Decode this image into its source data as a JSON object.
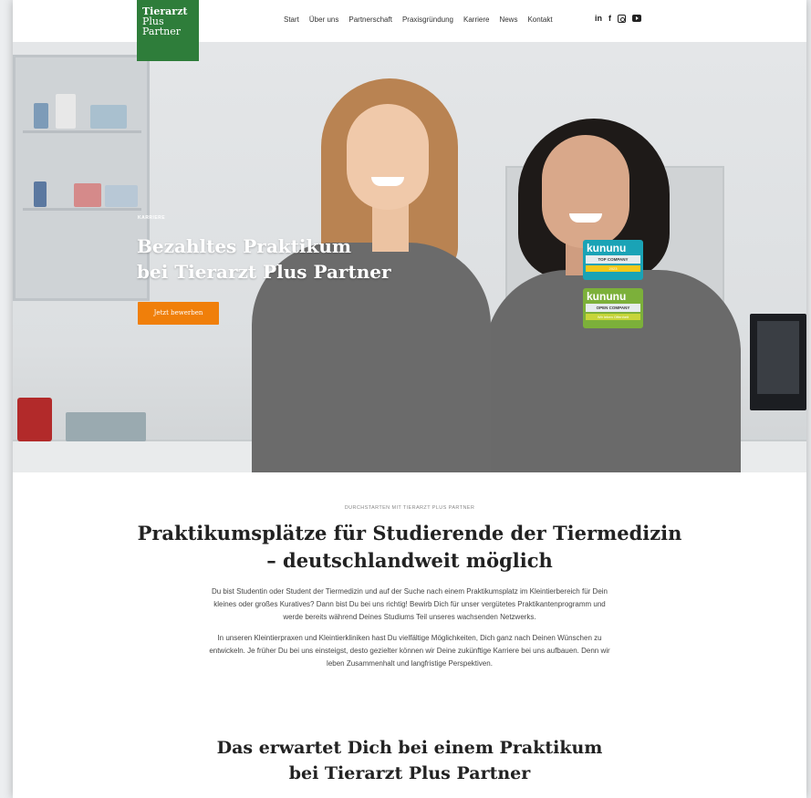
{
  "logo": {
    "line1": "Tierarzt",
    "line2": "Plus",
    "line3": "Partner"
  },
  "nav": {
    "items": [
      "Start",
      "Über uns",
      "Partnerschaft",
      "Praxisgründung",
      "Karriere",
      "News",
      "Kontakt"
    ]
  },
  "social": {
    "icons": [
      "linkedin-icon",
      "facebook-icon",
      "instagram-icon",
      "youtube-icon"
    ],
    "linkedin_text": "in",
    "facebook_text": "f"
  },
  "hero": {
    "eyebrow": "KARRIERE",
    "title_line1": "Bezahltes Praktikum",
    "title_line2": "bei Tierarzt Plus Partner",
    "cta": "Jetzt bewerben",
    "badges": [
      {
        "brand": "kununu",
        "sub": "TOP COMPANY",
        "tag": "2023"
      },
      {
        "brand": "kununu",
        "sub": "OPEN COMPANY",
        "tag": "Wir leben Offenheit"
      }
    ],
    "colors": {
      "cta": "#f07f0a",
      "logo": "#2e7d3a"
    }
  },
  "intro": {
    "eyebrow": "DURCHSTARTEN MIT TIERARZT PLUS PARTNER",
    "title_line1": "Praktikumsplätze für Studierende der Tiermedizin",
    "title_line2": "– deutschlandweit möglich",
    "para1_line1": "Du bist Studentin oder Student der Tiermedizin und auf der Suche nach einem Praktikumsplatz im Kleintierbereich für Dein",
    "para1_line2": "kleines oder großes Kuratives? Dann bist Du bei uns richtig! Bewirb Dich für unser vergütetes Praktikantenprogramm und",
    "para1_line3": "werde bereits während Deines Studiums Teil unseres wachsenden Netzwerks.",
    "para2_line1": "In unseren Kleintierpraxen und Kleintierkliniken hast Du vielfältige Möglichkeiten, Dich ganz nach Deinen Wünschen zu",
    "para2_line2": "entwickeln. Je früher Du bei uns einsteigst, desto gezielter können wir Deine zukünftige Karriere bei uns aufbauen. Denn wir",
    "para2_line3": "leben Zusammenhalt und langfristige Perspektiven."
  },
  "expect": {
    "title_line1": "Das erwartet Dich bei einem Praktikum",
    "title_line2": "bei Tierarzt Plus Partner"
  }
}
